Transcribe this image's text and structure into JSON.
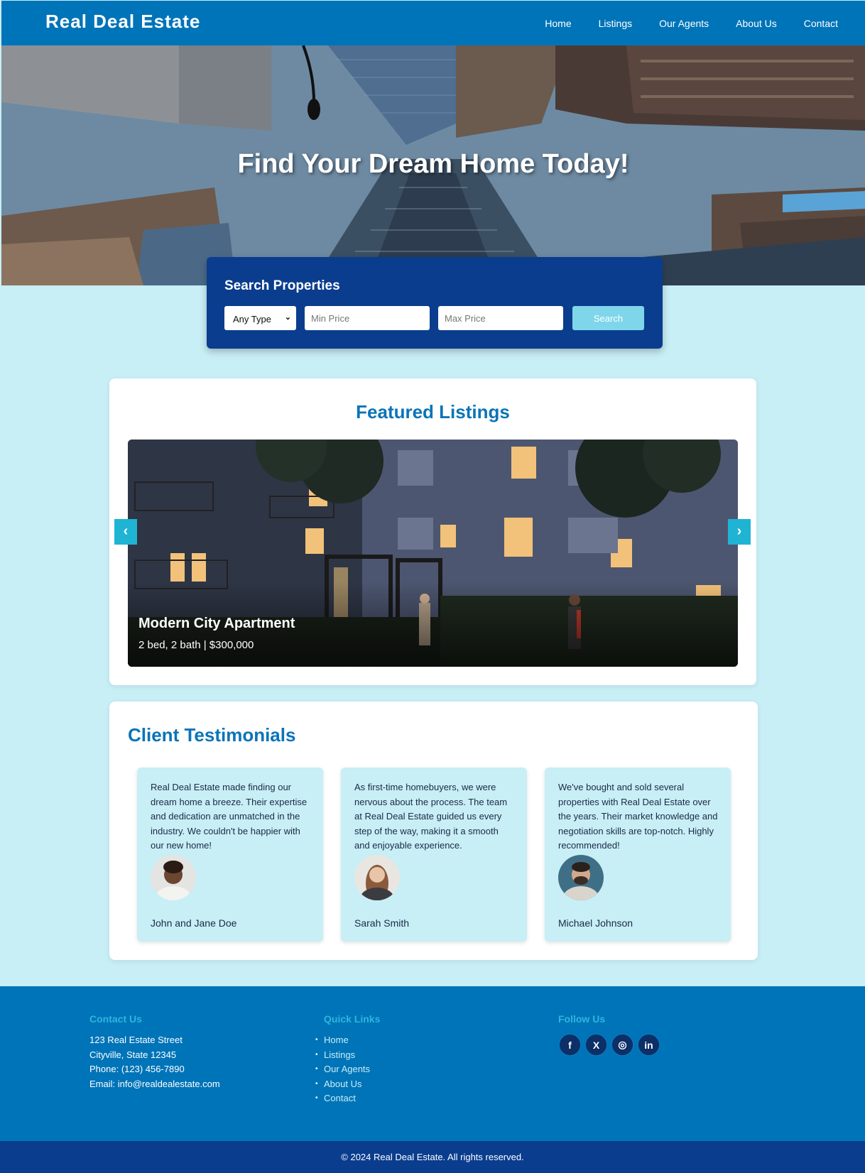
{
  "header": {
    "brand": "Real Deal Estate",
    "nav": [
      "Home",
      "Listings",
      "Our Agents",
      "About Us",
      "Contact"
    ]
  },
  "hero": {
    "title": "Find Your Dream Home Today!"
  },
  "search": {
    "title": "Search Properties",
    "type_selected": "Any Type",
    "min_placeholder": "Min Price",
    "max_placeholder": "Max Price",
    "button_label": "Search"
  },
  "featured": {
    "title": "Featured Listings",
    "slide_title": "Modern City Apartment",
    "slide_subtitle": "2 bed, 2 bath | $300,000",
    "prev_label": "‹",
    "next_label": "›"
  },
  "testimonials": {
    "title": "Client Testimonials",
    "items": [
      {
        "quote": "Real Deal Estate made finding our dream home a breeze. Their expertise and dedication are unmatched in the industry. We couldn't be happier with our new home!",
        "name": "John and Jane Doe"
      },
      {
        "quote": "As first-time homebuyers, we were nervous about the process. The team at Real Deal Estate guided us every step of the way, making it a smooth and enjoyable experience.",
        "name": "Sarah Smith"
      },
      {
        "quote": "We've bought and sold several properties with Real Deal Estate over the years. Their market knowledge and negotiation skills are top-notch. Highly recommended!",
        "name": "Michael Johnson"
      }
    ]
  },
  "footer": {
    "contact_title": "Contact Us",
    "contact_lines": [
      "123 Real Estate Street",
      "Cityville, State 12345",
      "Phone: (123) 456-7890",
      "Email: info@realdealestate.com"
    ],
    "links_title": "Quick Links",
    "links": [
      "Home",
      "Listings",
      "Our Agents",
      "About Us",
      "Contact"
    ],
    "follow_title": "Follow Us",
    "social": [
      "facebook-icon",
      "x-icon",
      "instagram-icon",
      "linkedin-icon"
    ],
    "social_glyphs": [
      "f",
      "X",
      "◎",
      "in"
    ],
    "copyright": "© 2024 Real Deal Estate. All rights reserved."
  },
  "colors": {
    "primary": "#0074b8",
    "dark": "#0a3d8e",
    "accent": "#1fb3d4",
    "background": "#c8eef6"
  }
}
